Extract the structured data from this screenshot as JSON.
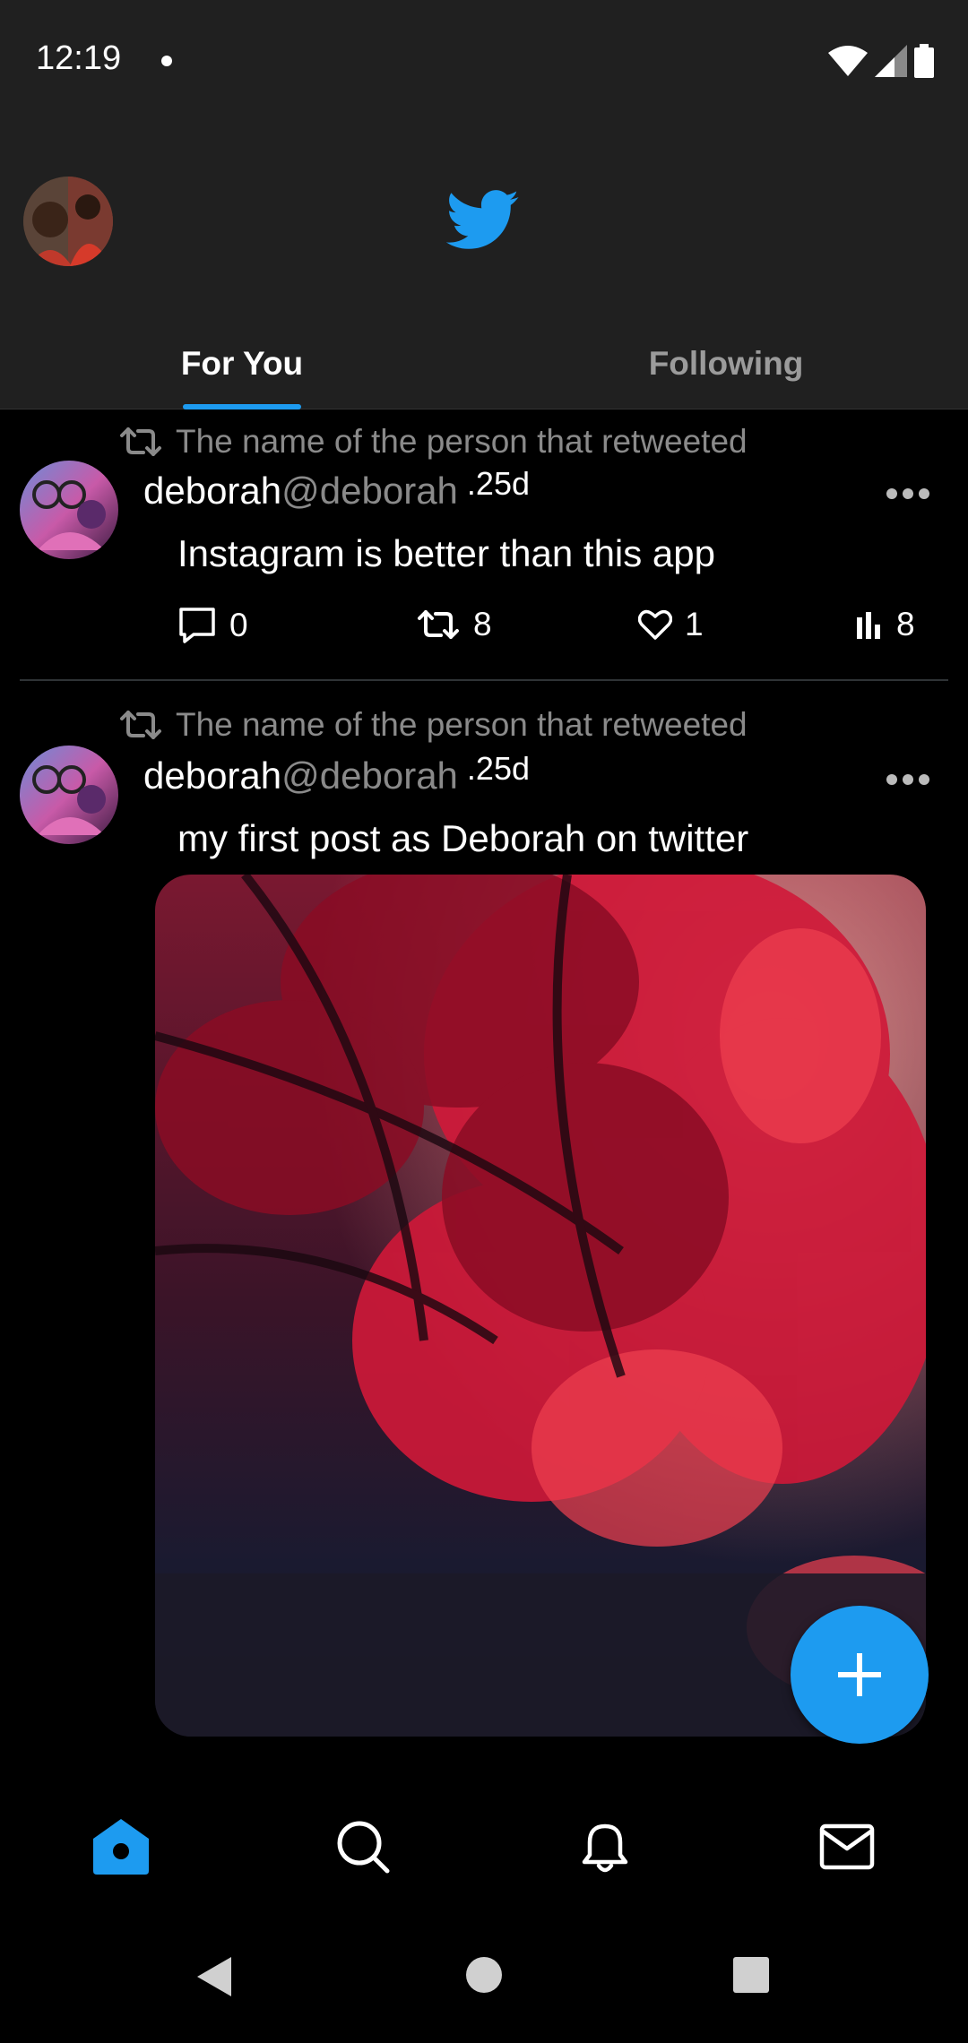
{
  "status_bar": {
    "time": "12:19"
  },
  "header": {
    "logo": "twitter-bird-icon",
    "tabs": [
      {
        "label": "For You",
        "active": true
      },
      {
        "label": "Following",
        "active": false
      }
    ]
  },
  "feed": [
    {
      "retweet_text": "The name of the person that retweeted",
      "name": "deborah",
      "handle": "@deborah",
      "time": ".25d",
      "text": "Instagram is better than this app",
      "replies": "0",
      "retweets": "8",
      "likes": "1",
      "views": "8"
    },
    {
      "retweet_text": "The name of the person that retweeted",
      "name": "deborah",
      "handle": "@deborah",
      "time": ".25d",
      "text": "my first post as Deborah on twitter"
    }
  ],
  "colors": {
    "accent": "#1d9bf0",
    "background": "#000000",
    "header": "#202020"
  },
  "bottom_nav": [
    "home-icon",
    "search-icon",
    "bell-icon",
    "mail-icon"
  ]
}
